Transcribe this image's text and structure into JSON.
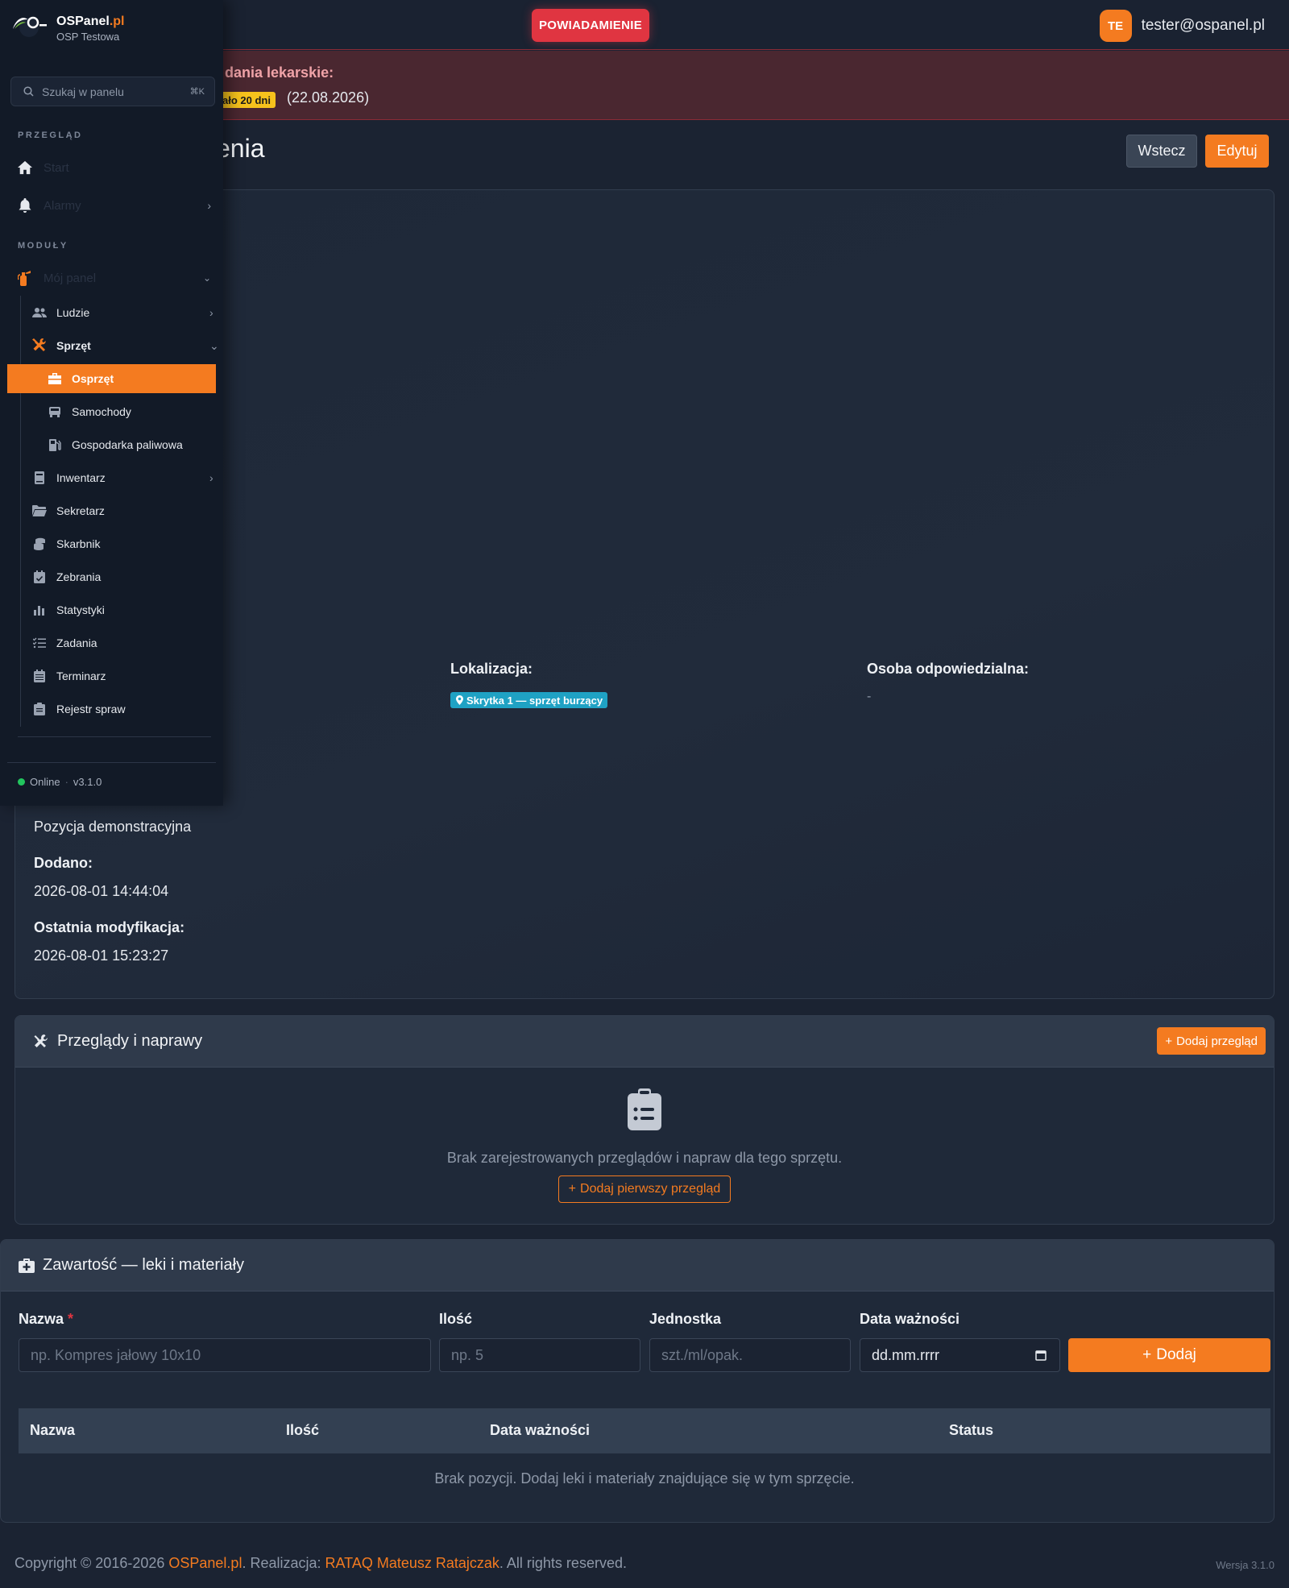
{
  "topbar": {
    "notification_label": "POWIADAMIENIE",
    "user_initials": "TE",
    "user_email": "tester@ospanel.pl"
  },
  "alert": {
    "title": "dania lekarskie:",
    "badge": "ało 20 dni",
    "date": "(22.08.2026)"
  },
  "page": {
    "title": "enia",
    "back_label": "Wstecz",
    "edit_label": "Edytuj"
  },
  "details": {
    "location_label": "Lokalizacja:",
    "location_value": "Skrytka 1 — sprzęt burzący",
    "responsible_label": "Osoba odpowiedzialna:",
    "responsible_value": "-",
    "notes_value": "Pozycja demonstracyjna",
    "added_label": "Dodano:",
    "added_value": "2026-08-01 14:44:04",
    "modified_label": "Ostatnia modyfikacja:",
    "modified_value": "2026-08-01 15:23:27"
  },
  "reviews": {
    "title": "Przeglądy i naprawy",
    "add_label": "Dodaj przegląd",
    "empty_text": "Brak zarejestrowanych przeglądów i napraw dla tego sprzętu.",
    "add_first_label": "Dodaj pierwszy przegląd"
  },
  "contents": {
    "title": "Zawartość — leki i materiały",
    "form": {
      "name_label": "Nazwa",
      "name_required": "*",
      "name_placeholder": "np. Kompres jałowy 10x10",
      "qty_label": "Ilość",
      "qty_placeholder": "np. 5",
      "unit_label": "Jednostka",
      "unit_placeholder": "szt./ml/opak.",
      "expiry_label": "Data ważności",
      "expiry_placeholder": "dd.mm.rrrr",
      "add_label": "Dodaj"
    },
    "table": {
      "columns": [
        "Nazwa",
        "Ilość",
        "Data ważności",
        "Status"
      ],
      "empty_text": "Brak pozycji. Dodaj leki i materiały znajdujące się w tym sprzęcie."
    }
  },
  "footer": {
    "copyright_prefix": "Copyright © 2016-2026 ",
    "brand": "OSPanel.pl",
    "realization_prefix": ". Realizacja: ",
    "author": "RATAQ Mateusz Ratajczak",
    "suffix": ". All rights reserved.",
    "version": "Wersja 3.1.0"
  },
  "sidebar": {
    "brand_name": "OSPanel",
    "brand_tld": ".pl",
    "org_name": "OSP Testowa",
    "search_placeholder": "Szukaj w panelu",
    "search_shortcut": "⌘K",
    "section_overview": "PRZEGLĄD",
    "start_label": "Start",
    "alarms_label": "Alarmy",
    "section_modules": "MODUŁY",
    "my_panel_label": "Mój panel",
    "items": [
      {
        "label": "Ludzie",
        "icon": "users-icon"
      },
      {
        "label": "Sprzęt",
        "icon": "tools-icon"
      },
      {
        "label": "Osprzęt",
        "icon": "toolbox-icon"
      },
      {
        "label": "Samochody",
        "icon": "truck-icon"
      },
      {
        "label": "Gospodarka paliwowa",
        "icon": "fuel-icon"
      },
      {
        "label": "Inwentarz",
        "icon": "book-icon"
      },
      {
        "label": "Sekretarz",
        "icon": "folder-icon"
      },
      {
        "label": "Skarbnik",
        "icon": "coins-icon"
      },
      {
        "label": "Zebrania",
        "icon": "calendar-check-icon"
      },
      {
        "label": "Statystyki",
        "icon": "chart-icon"
      },
      {
        "label": "Zadania",
        "icon": "tasks-icon"
      },
      {
        "label": "Terminarz",
        "icon": "calendar-icon"
      },
      {
        "label": "Rejestr spraw",
        "icon": "clipboard-icon"
      }
    ],
    "status_label": "Online",
    "version": "v3.1.0"
  },
  "colors": {
    "accent": "#f47b20",
    "danger": "#e03541",
    "info": "#1fa2c4",
    "success": "#22c55e"
  }
}
